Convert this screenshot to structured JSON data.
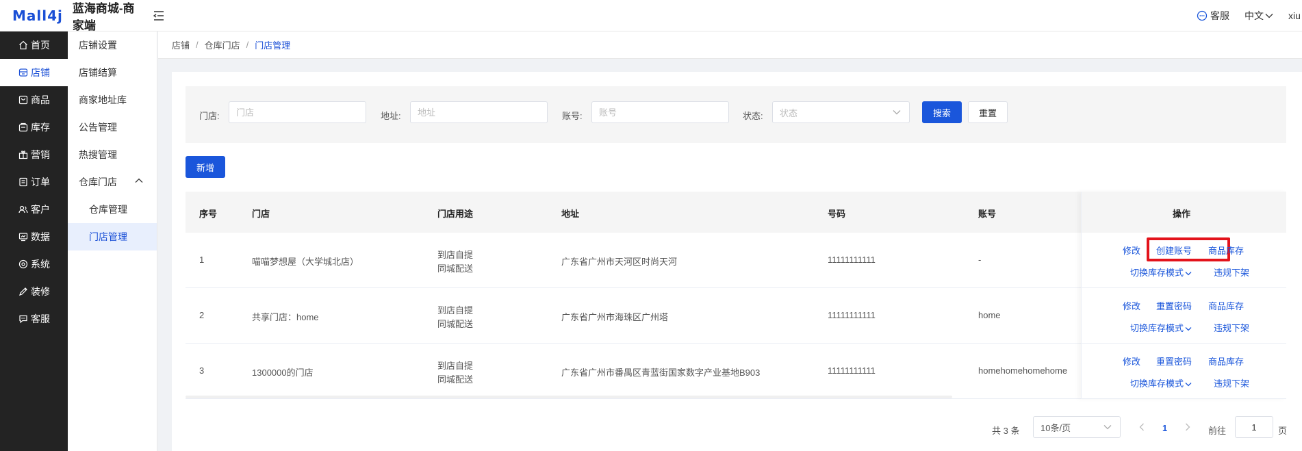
{
  "header": {
    "logo": "Mall4j",
    "app_title": "蓝海商城-商家端",
    "customer_service": "客服",
    "language": "中文",
    "user": "xiu"
  },
  "sidebar": {
    "items": [
      {
        "label": "首页",
        "icon": "home-icon"
      },
      {
        "label": "店铺",
        "icon": "store-icon"
      },
      {
        "label": "商品",
        "icon": "goods-icon"
      },
      {
        "label": "库存",
        "icon": "inventory-icon"
      },
      {
        "label": "营销",
        "icon": "gift-icon"
      },
      {
        "label": "订单",
        "icon": "order-icon"
      },
      {
        "label": "客户",
        "icon": "customer-icon"
      },
      {
        "label": "数据",
        "icon": "data-icon"
      },
      {
        "label": "系统",
        "icon": "settings-icon"
      },
      {
        "label": "装修",
        "icon": "decorate-icon"
      },
      {
        "label": "客服",
        "icon": "chat-icon"
      }
    ],
    "active": "店铺"
  },
  "subnav": {
    "items": [
      "店铺设置",
      "店铺结算",
      "商家地址库",
      "公告管理",
      "热搜管理",
      "仓库门店"
    ],
    "children": [
      "仓库管理",
      "门店管理"
    ],
    "active": "门店管理"
  },
  "breadcrumb": [
    "店铺",
    "仓库门店",
    "门店管理"
  ],
  "filter": {
    "store_label": "门店:",
    "store_placeholder": "门店",
    "address_label": "地址:",
    "address_placeholder": "地址",
    "account_label": "账号:",
    "account_placeholder": "账号",
    "status_label": "状态:",
    "status_placeholder": "状态",
    "search_button": "搜索",
    "reset_button": "重置"
  },
  "add_button": "新增",
  "table": {
    "columns": [
      "序号",
      "门店",
      "门店用途",
      "地址",
      "号码",
      "账号",
      "操作"
    ],
    "rows": [
      {
        "index": "1",
        "store": "喵喵梦想屋（大学城北店）",
        "usage": [
          "到店自提",
          "同城配送"
        ],
        "address": "广东省广州市天河区时尚天河",
        "phone": "11111111111",
        "account": "-",
        "actions": [
          "修改",
          "创建账号",
          "商品库存",
          "切换库存模式",
          "违规下架"
        ]
      },
      {
        "index": "2",
        "store": "共享门店：home",
        "usage": [
          "到店自提",
          "同城配送"
        ],
        "address": "广东省广州市海珠区广州塔",
        "phone": "11111111111",
        "account": "home",
        "actions": [
          "修改",
          "重置密码",
          "商品库存",
          "切换库存模式",
          "违规下架"
        ]
      },
      {
        "index": "3",
        "store": "1300000的门店",
        "usage": [
          "到店自提",
          "同城配送"
        ],
        "address": "广东省广州市番禺区青蓝街国家数字产业基地B903",
        "phone": "11111111111",
        "account": "homehomehomehome",
        "actions": [
          "修改",
          "重置密码",
          "商品库存",
          "切换库存模式",
          "违规下架"
        ]
      }
    ]
  },
  "pagination": {
    "total_text": "共 3 条",
    "page_size": "10条/页",
    "current_page": "1",
    "goto_label": "前往",
    "goto_value": "1",
    "page_suffix": "页"
  },
  "colors": {
    "primary": "#1a56db",
    "sidebar_bg": "#232323",
    "highlight_border": "#e3131b"
  }
}
